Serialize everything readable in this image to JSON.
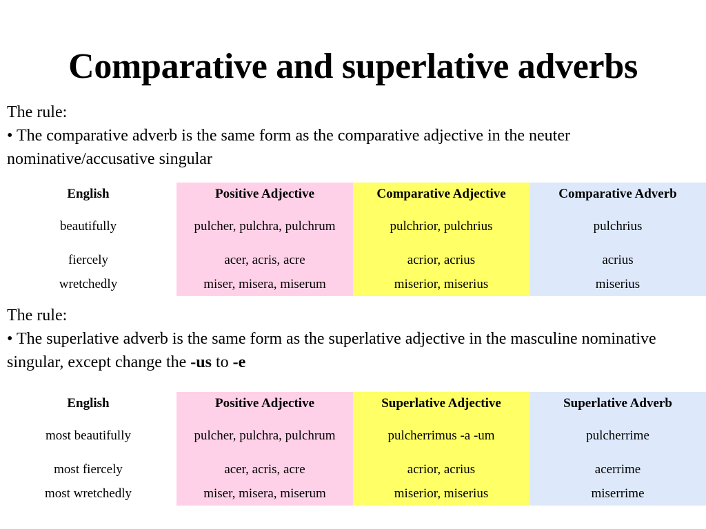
{
  "slide": {
    "title": "Comparative and superlative adverbs"
  },
  "colors": {
    "positive_column": "#ffd1e8",
    "adjective_column": "#ffff66",
    "adverb_column": "#dde9fb"
  },
  "rule1": {
    "heading": "The rule:",
    "bullet": "• The comparative adverb is the same form as the comparative adjective in the neuter nominative/accusative singular"
  },
  "table1": {
    "headers": [
      "English",
      "Positive Adjective",
      "Comparative Adjective",
      "Comparative Adverb"
    ],
    "rows": [
      [
        "beautifully",
        "pulcher, pulchra, pulchrum",
        "pulchrior, pulchrius",
        "pulchrius"
      ],
      [
        "fiercely",
        "acer, acris, acre",
        "acrior, acrius",
        "acrius"
      ],
      [
        "wretchedly",
        "miser, misera, miserum",
        "miserior, miserius",
        "miserius"
      ]
    ]
  },
  "rule2": {
    "heading": "The rule:",
    "bullet_prefix": "• The superlative adverb is the same form as the superlative adjective in the masculine nominative singular, except change the ",
    "ending_from": "-us",
    "connector": " to ",
    "ending_to": "-e"
  },
  "table2": {
    "headers": [
      "English",
      "Positive Adjective",
      "Superlative Adjective",
      "Superlative Adverb"
    ],
    "rows": [
      [
        "most beautifully",
        "pulcher, pulchra, pulchrum",
        "pulcherrimus -a -um",
        "pulcherrime"
      ],
      [
        "most fiercely",
        "acer, acris, acre",
        "acrior, acrius",
        "acerrime"
      ],
      [
        "most wretchedly",
        "miser, misera, miserum",
        "miserior, miserius",
        "miserrime"
      ]
    ]
  }
}
